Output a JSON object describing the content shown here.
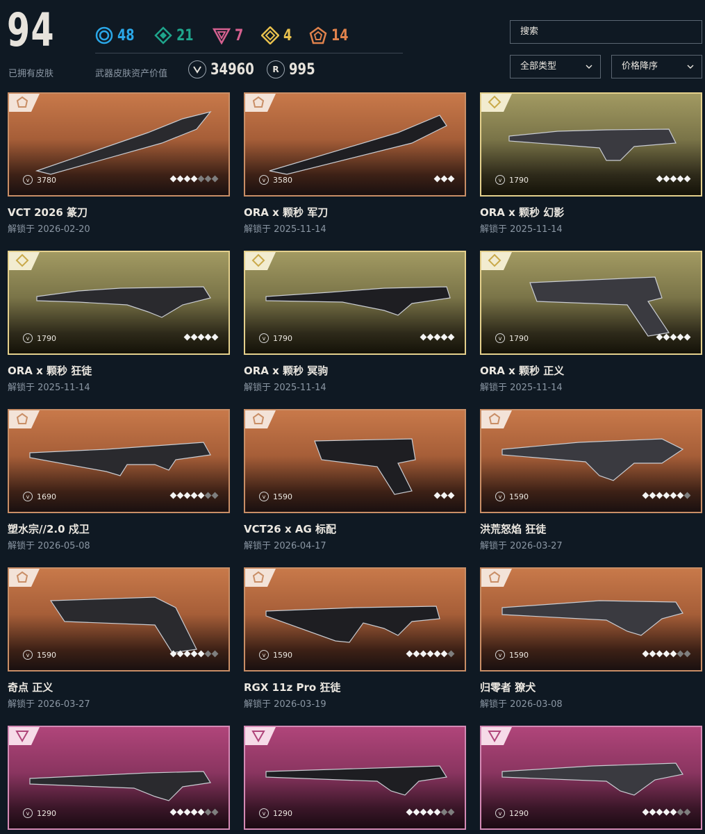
{
  "header": {
    "owned_count": "94",
    "owned_label": "已拥有皮肤",
    "value_label": "武器皮肤资产价值",
    "tiers": [
      {
        "name": "select-tier",
        "count": "48",
        "color": "#2aa7e8",
        "icon": "select-tier-icon"
      },
      {
        "name": "deluxe-tier",
        "count": "21",
        "color": "#1fa58c",
        "icon": "deluxe-tier-icon"
      },
      {
        "name": "premium-tier",
        "count": "7",
        "color": "#d5608f",
        "icon": "premium-tier-icon"
      },
      {
        "name": "exclusive-tier",
        "count": "4",
        "color": "#e8c14e",
        "icon": "exclusive-tier-icon"
      },
      {
        "name": "ultra-tier",
        "count": "14",
        "color": "#e0824c",
        "icon": "ultra-tier-icon"
      }
    ],
    "currencies": [
      {
        "icon": "valorant-points-icon",
        "amount": "34960"
      },
      {
        "icon": "radianite-points-icon",
        "symbol": "R",
        "amount": "995"
      }
    ]
  },
  "controls": {
    "search_label": "搜索",
    "type_filter": "全部类型",
    "sort_order": "价格降序"
  },
  "skins": [
    {
      "name": "VCT 2026 篆刀",
      "date": "解锁于 2026-02-20",
      "price": "3780",
      "tier": "premium",
      "stars_on": 4,
      "stars_total": 7
    },
    {
      "name": "ORA x 颗秒 军刀",
      "date": "解锁于 2025-11-14",
      "price": "3580",
      "tier": "premium",
      "stars_on": 3,
      "stars_total": 3
    },
    {
      "name": "ORA x 颗秒 幻影",
      "date": "解锁于 2025-11-14",
      "price": "1790",
      "tier": "exclusive",
      "stars_on": 5,
      "stars_total": 5
    },
    {
      "name": "ORA x 颗秒 狂徒",
      "date": "解锁于 2025-11-14",
      "price": "1790",
      "tier": "exclusive",
      "stars_on": 5,
      "stars_total": 5
    },
    {
      "name": "ORA x 颗秒 冥驹",
      "date": "解锁于 2025-11-14",
      "price": "1790",
      "tier": "exclusive",
      "stars_on": 5,
      "stars_total": 5
    },
    {
      "name": "ORA x 颗秒 正义",
      "date": "解锁于 2025-11-14",
      "price": "1790",
      "tier": "exclusive",
      "stars_on": 5,
      "stars_total": 5
    },
    {
      "name": "塑水宗//2.0 戍卫",
      "date": "解锁于 2026-05-08",
      "price": "1690",
      "tier": "premium",
      "stars_on": 5,
      "stars_total": 7
    },
    {
      "name": "VCT26 x AG 标配",
      "date": "解锁于 2026-04-17",
      "price": "1590",
      "tier": "premium",
      "stars_on": 3,
      "stars_total": 3
    },
    {
      "name": "洪荒怒焰 狂徒",
      "date": "解锁于 2026-03-27",
      "price": "1590",
      "tier": "premium",
      "stars_on": 6,
      "stars_total": 7
    },
    {
      "name": "奇点 正义",
      "date": "解锁于 2026-03-27",
      "price": "1590",
      "tier": "premium",
      "stars_on": 5,
      "stars_total": 7
    },
    {
      "name": "RGX 11z Pro 狂徒",
      "date": "解锁于 2026-03-19",
      "price": "1590",
      "tier": "premium",
      "stars_on": 6,
      "stars_total": 7
    },
    {
      "name": "归零者 獠犬",
      "date": "解锁于 2026-03-08",
      "price": "1590",
      "tier": "premium",
      "stars_on": 5,
      "stars_total": 7
    },
    {
      "name": "",
      "date": "",
      "price": "1290",
      "tier": "deluxe",
      "stars_on": 5,
      "stars_total": 7
    },
    {
      "name": "",
      "date": "",
      "price": "1290",
      "tier": "deluxe",
      "stars_on": 5,
      "stars_total": 7
    },
    {
      "name": "",
      "date": "",
      "price": "1290",
      "tier": "deluxe",
      "stars_on": 5,
      "stars_total": 7
    }
  ]
}
